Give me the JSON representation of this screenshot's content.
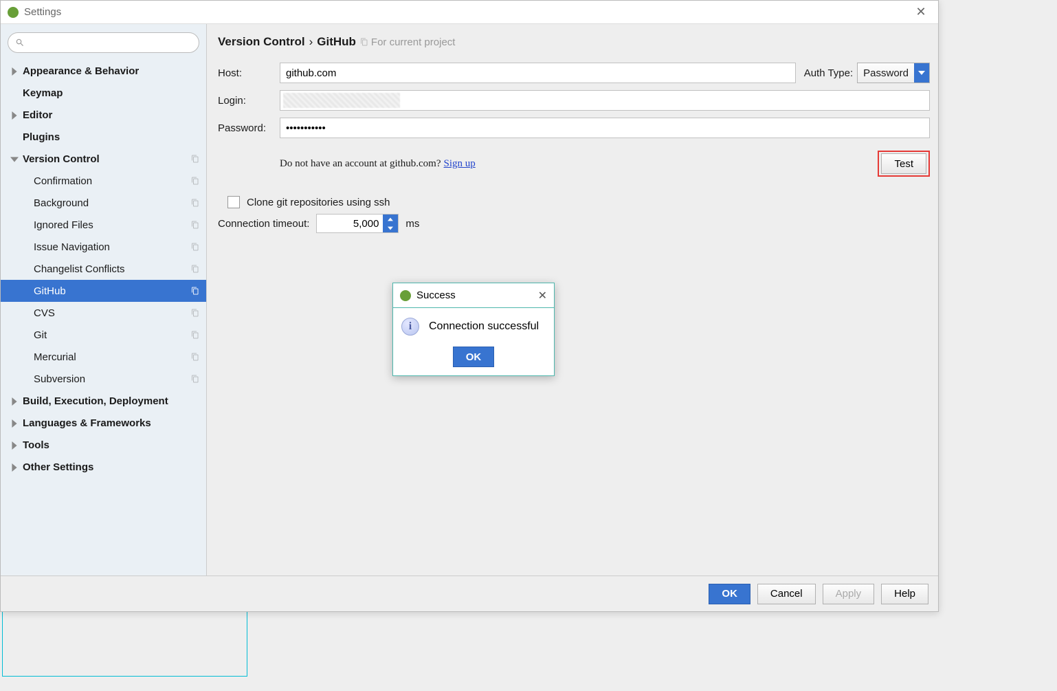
{
  "window_title": "Settings",
  "search_placeholder": "",
  "sidebar": {
    "items": [
      {
        "label": "Appearance & Behavior",
        "level": 0,
        "expandable": true,
        "expanded": false,
        "copy": false
      },
      {
        "label": "Keymap",
        "level": 0,
        "expandable": false,
        "copy": false
      },
      {
        "label": "Editor",
        "level": 0,
        "expandable": true,
        "expanded": false,
        "copy": false
      },
      {
        "label": "Plugins",
        "level": 0,
        "expandable": false,
        "copy": false
      },
      {
        "label": "Version Control",
        "level": 0,
        "expandable": true,
        "expanded": true,
        "copy": true
      },
      {
        "label": "Confirmation",
        "level": 1,
        "copy": true
      },
      {
        "label": "Background",
        "level": 1,
        "copy": true
      },
      {
        "label": "Ignored Files",
        "level": 1,
        "copy": true
      },
      {
        "label": "Issue Navigation",
        "level": 1,
        "copy": true
      },
      {
        "label": "Changelist Conflicts",
        "level": 1,
        "copy": true
      },
      {
        "label": "GitHub",
        "level": 1,
        "copy": true,
        "selected": true
      },
      {
        "label": "CVS",
        "level": 1,
        "copy": true
      },
      {
        "label": "Git",
        "level": 1,
        "copy": true
      },
      {
        "label": "Mercurial",
        "level": 1,
        "copy": true
      },
      {
        "label": "Subversion",
        "level": 1,
        "copy": true
      },
      {
        "label": "Build, Execution, Deployment",
        "level": 0,
        "expandable": true,
        "expanded": false,
        "copy": false
      },
      {
        "label": "Languages & Frameworks",
        "level": 0,
        "expandable": true,
        "expanded": false,
        "copy": false
      },
      {
        "label": "Tools",
        "level": 0,
        "expandable": true,
        "expanded": false,
        "copy": false
      },
      {
        "label": "Other Settings",
        "level": 0,
        "expandable": true,
        "expanded": false,
        "copy": false
      }
    ]
  },
  "breadcrumb": {
    "seg1": "Version Control",
    "sep": "›",
    "seg2": "GitHub",
    "hint": "For current project"
  },
  "form": {
    "host_label": "Host:",
    "host_value": "github.com",
    "auth_label": "Auth Type:",
    "auth_value": "Password",
    "login_label": "Login:",
    "login_value": "",
    "password_label": "Password:",
    "password_value": "•••••••••••",
    "noacct_text": "Do not have an account at github.com?",
    "signup_label": "Sign up",
    "test_label": "Test",
    "ssh_label": "Clone git repositories using ssh",
    "ssh_checked": false,
    "timeout_label": "Connection timeout:",
    "timeout_value": "5,000",
    "timeout_unit": "ms"
  },
  "dialog": {
    "title": "Success",
    "message": "Connection successful",
    "ok_label": "OK"
  },
  "footer": {
    "ok": "OK",
    "cancel": "Cancel",
    "apply": "Apply",
    "help": "Help"
  }
}
